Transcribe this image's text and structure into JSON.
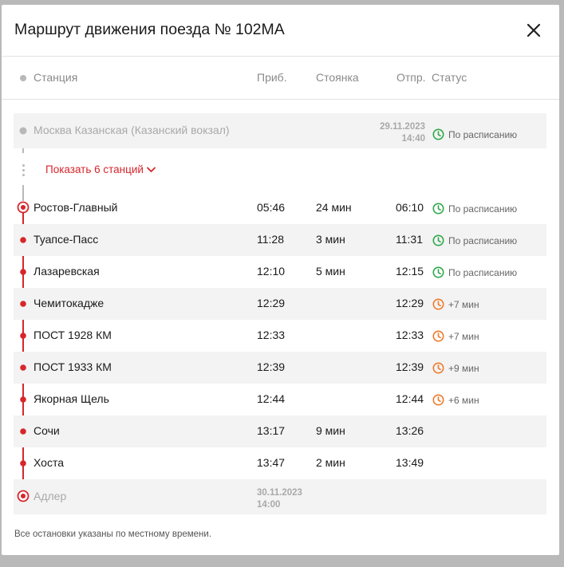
{
  "title": "Маршрут движения поезда № 102МА",
  "columns": {
    "station": "Станция",
    "arrival": "Приб.",
    "stop": "Стоянка",
    "departure": "Отпр.",
    "status": "Статус"
  },
  "first_station": {
    "name": "Москва Казанская (Казанский вокзал)",
    "departure_date": "29.11.2023",
    "departure_time": "14:40",
    "status": "По расписанию"
  },
  "show_more_label": "Показать 6 станций",
  "stations": [
    {
      "name": "Ростов-Главный",
      "arrival": "05:46",
      "stop": "24 мин",
      "departure": "06:10",
      "status": "По расписанию"
    },
    {
      "name": "Туапсе-Пасс",
      "arrival": "11:28",
      "stop": "3 мин",
      "departure": "11:31",
      "status": "По расписанию"
    },
    {
      "name": "Лазаревская",
      "arrival": "12:10",
      "stop": "5 мин",
      "departure": "12:15",
      "status": "По расписанию"
    },
    {
      "name": "Чемитокадже",
      "arrival": "12:29",
      "stop": "",
      "departure": "12:29",
      "status": "+7 мин"
    },
    {
      "name": "ПОСТ 1928 КМ",
      "arrival": "12:33",
      "stop": "",
      "departure": "12:33",
      "status": "+7 мин"
    },
    {
      "name": "ПОСТ 1933 КМ",
      "arrival": "12:39",
      "stop": "",
      "departure": "12:39",
      "status": "+9 мин"
    },
    {
      "name": "Якорная Щель",
      "arrival": "12:44",
      "stop": "",
      "departure": "12:44",
      "status": "+6 мин"
    },
    {
      "name": "Сочи",
      "arrival": "13:17",
      "stop": "9 мин",
      "departure": "13:26",
      "status": ""
    },
    {
      "name": "Хоста",
      "arrival": "13:47",
      "stop": "2 мин",
      "departure": "13:49",
      "status": ""
    }
  ],
  "last_station": {
    "name": "Адлер",
    "arrival_date": "30.11.2023",
    "arrival_time": "14:00"
  },
  "footer_note": "Все остановки указаны по местному времени.",
  "colors": {
    "accent_red": "#d7262b",
    "on_time_green": "#2ea84a",
    "delay_orange": "#ee7a2c",
    "muted_gray": "#b8b8b8"
  },
  "icons": {
    "close": "close-icon",
    "chevron": "chevron-down-icon",
    "clock": "clock-icon"
  }
}
